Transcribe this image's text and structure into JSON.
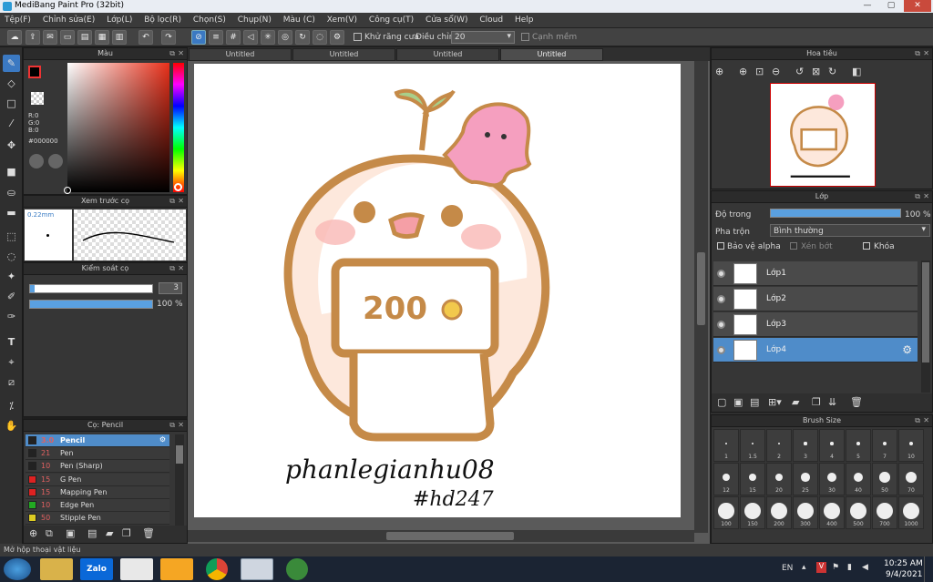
{
  "window": {
    "title": "MediBang Paint Pro (32bit)",
    "minimize": "—",
    "maximize": "▢",
    "close": "✕"
  },
  "menu": [
    "Tệp(F)",
    "Chỉnh sửa(E)",
    "Lớp(L)",
    "Bộ lọc(R)",
    "Chọn(S)",
    "Chụp(N)",
    "Màu (C)",
    "Xem(V)",
    "Công cụ(T)",
    "Cửa sổ(W)",
    "Cloud",
    "Help"
  ],
  "toolbar": {
    "antialias_label": "Khử răng cưa",
    "adjust_label": "Điều chỉnh",
    "adjust_value": "20",
    "smooth_label": "Cạnh mềm"
  },
  "color_panel": {
    "title": "Màu",
    "r": "R:0",
    "g": "G:0",
    "b": "B:0",
    "hex": "#000000",
    "fg": "#000000",
    "bg": "#ff44cc"
  },
  "brush_preview": {
    "title": "Xem trước cọ",
    "size": "0.22mm"
  },
  "brush_control": {
    "title": "Kiểm soát cọ",
    "size_value": "3",
    "opacity_value": "100 %",
    "size_fraction": 0.03,
    "opacity_fraction": 1.0
  },
  "brush_list": {
    "title": "Cọ: Pencil",
    "items": [
      {
        "size": "3.0",
        "name": "Pencil",
        "color": "#222222",
        "selected": true
      },
      {
        "size": "21",
        "name": "Pen",
        "color": "#222222",
        "selected": false
      },
      {
        "size": "10",
        "name": "Pen (Sharp)",
        "color": "#222222",
        "selected": false
      },
      {
        "size": "15",
        "name": "G Pen",
        "color": "#dd2222",
        "selected": false
      },
      {
        "size": "15",
        "name": "Mapping Pen",
        "color": "#dd2222",
        "selected": false
      },
      {
        "size": "10",
        "name": "Edge Pen",
        "color": "#22aa22",
        "selected": false
      },
      {
        "size": "50",
        "name": "Stipple Pen",
        "color": "#ddcc22",
        "selected": false
      }
    ]
  },
  "canvas": {
    "tabs": [
      "Untitled",
      "Untitled",
      "Untitled",
      "Untitled"
    ],
    "artwork_text_1": "200",
    "artwork_signature_1": "phanlegianhu08",
    "artwork_signature_2": "#hd247"
  },
  "navigator": {
    "title": "Hoa tiêu"
  },
  "layer_panel": {
    "title": "Lớp",
    "opacity_label": "Độ trong",
    "opacity_value": "100 %",
    "opacity_fraction": 1.0,
    "blend_label": "Pha trộn",
    "blend_value": "Bình thường",
    "protect_alpha": "Bảo vệ alpha",
    "clipping": "Xén bớt",
    "lock": "Khóa",
    "layers": [
      {
        "name": "Lớp1",
        "selected": false
      },
      {
        "name": "Lớp2",
        "selected": false
      },
      {
        "name": "Lớp3",
        "selected": false
      },
      {
        "name": "Lớp4",
        "selected": true
      }
    ]
  },
  "brush_size_panel": {
    "title": "Brush Size",
    "sizes": [
      "1",
      "1.5",
      "2",
      "3",
      "4",
      "5",
      "7",
      "10",
      "12",
      "15",
      "20",
      "25",
      "30",
      "40",
      "50",
      "70",
      "100",
      "150",
      "200",
      "300",
      "400",
      "500",
      "700",
      "1000"
    ]
  },
  "status": {
    "text": "Mở hộp thoại vật liệu"
  },
  "taskbar": {
    "lang": "EN",
    "time": "10:25 AM",
    "date": "9/4/2021",
    "zalo_label": "Zalo"
  }
}
